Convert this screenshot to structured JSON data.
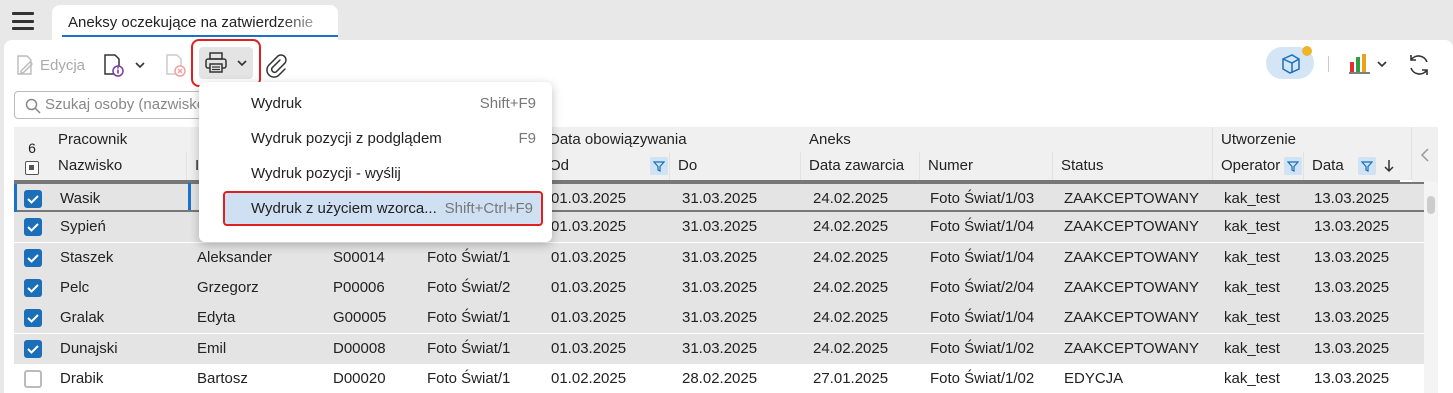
{
  "tab": {
    "title": "Aneksy oczekujące na zatwierdzenie"
  },
  "toolbar": {
    "edit_label": "Edycja"
  },
  "search": {
    "placeholder": "Szukaj osoby (nazwisko"
  },
  "grid": {
    "count": "6",
    "groups": {
      "employee": "Pracownik",
      "validity": "Data obowiązywania",
      "annex": "Aneks",
      "creation": "Utworzenie"
    },
    "columns": {
      "surname": "Nazwisko",
      "firstname": "I",
      "from": "Od",
      "to": "Do",
      "date_signed": "Data zawarcia",
      "number": "Numer",
      "status": "Status",
      "operator": "Operator",
      "date": "Data"
    },
    "rows": [
      {
        "checked": true,
        "surname": "Wasik",
        "first": "",
        "code": "",
        "pos": "",
        "from": "01.03.2025",
        "to": "31.03.2025",
        "signed": "24.02.2025",
        "number": "Foto Świat/1/03",
        "status": "ZAAKCEPTOWANY",
        "operator": "kak_test",
        "date": "13.03.2025"
      },
      {
        "checked": true,
        "surname": "Sypień",
        "first": "",
        "code": "",
        "pos": "",
        "from": "01.03.2025",
        "to": "31.03.2025",
        "signed": "24.02.2025",
        "number": "Foto Świat/1/04",
        "status": "ZAAKCEPTOWANY",
        "operator": "kak_test",
        "date": "13.03.2025"
      },
      {
        "checked": true,
        "surname": "Staszek",
        "first": "Aleksander",
        "code": "S00014",
        "pos": "Foto Świat/1",
        "from": "01.03.2025",
        "to": "31.03.2025",
        "signed": "24.02.2025",
        "number": "Foto Świat/1/04",
        "status": "ZAAKCEPTOWANY",
        "operator": "kak_test",
        "date": "13.03.2025"
      },
      {
        "checked": true,
        "surname": "Pelc",
        "first": "Grzegorz",
        "code": "P00006",
        "pos": "Foto Świat/2",
        "from": "01.03.2025",
        "to": "31.03.2025",
        "signed": "24.02.2025",
        "number": "Foto Świat/2/04",
        "status": "ZAAKCEPTOWANY",
        "operator": "kak_test",
        "date": "13.03.2025"
      },
      {
        "checked": true,
        "surname": "Gralak",
        "first": "Edyta",
        "code": "G00005",
        "pos": "Foto Świat/1",
        "from": "01.03.2025",
        "to": "31.03.2025",
        "signed": "24.02.2025",
        "number": "Foto Świat/1/04",
        "status": "ZAAKCEPTOWANY",
        "operator": "kak_test",
        "date": "13.03.2025"
      },
      {
        "checked": true,
        "surname": "Dunajski",
        "first": "Emil",
        "code": "D00008",
        "pos": "Foto Świat/1",
        "from": "01.03.2025",
        "to": "31.03.2025",
        "signed": "24.02.2025",
        "number": "Foto Świat/1/02",
        "status": "ZAAKCEPTOWANY",
        "operator": "kak_test",
        "date": "13.03.2025"
      },
      {
        "checked": false,
        "surname": "Drabik",
        "first": "Bartosz",
        "code": "D00020",
        "pos": "Foto Świat/1",
        "from": "01.02.2025",
        "to": "28.02.2025",
        "signed": "27.01.2025",
        "number": "Foto Świat/1/02",
        "status": "EDYCJA",
        "operator": "kak_test",
        "date": "13.03.2025"
      }
    ]
  },
  "print_menu": {
    "items": [
      {
        "label": "Wydruk",
        "shortcut": "Shift+F9"
      },
      {
        "label": "Wydruk pozycji z podglądem",
        "shortcut": "F9"
      },
      {
        "label": "Wydruk pozycji - wyślij",
        "shortcut": ""
      },
      {
        "label": "Wydruk z użyciem wzorca...",
        "shortcut": "Shift+Ctrl+F9"
      }
    ]
  },
  "colors": {
    "accent": "#1a6fb8",
    "highlight_border": "#e02020",
    "selected_row": "#e4e4e4"
  },
  "icons": [
    "menu-icon",
    "edit-icon",
    "document-info-icon",
    "document-delete-icon",
    "printer-icon",
    "paperclip-icon",
    "search-icon",
    "filter-icon",
    "sort-down-icon",
    "cube-icon",
    "bar-chart-icon",
    "refresh-icon",
    "chevron-left-icon"
  ]
}
